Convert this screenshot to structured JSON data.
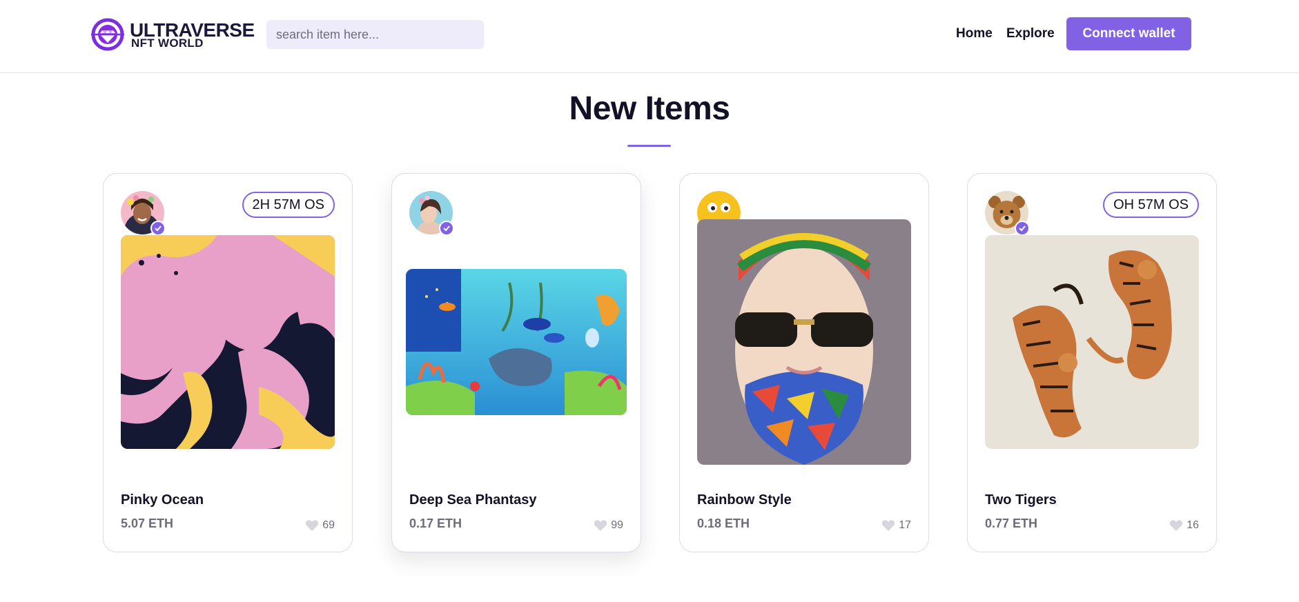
{
  "header": {
    "logo_line1": "ULTRAVERSE",
    "logo_line2": "NFT WORLD",
    "search_placeholder": "search item here...",
    "nav": {
      "home": "Home",
      "explore": "Explore"
    },
    "connect_label": "Connect wallet"
  },
  "section": {
    "title": "New Items"
  },
  "colors": {
    "accent": "#8162e4",
    "text_dark": "#131126",
    "search_bg": "#eeecfa"
  },
  "items": [
    {
      "name": "Pinky Ocean",
      "price": "5.07 ETH",
      "likes": "69",
      "countdown": "2H 57M OS"
    },
    {
      "name": "Deep Sea Phantasy",
      "price": "0.17 ETH",
      "likes": "99",
      "countdown": ""
    },
    {
      "name": "Rainbow Style",
      "price": "0.18 ETH",
      "likes": "17",
      "countdown": ""
    },
    {
      "name": "Two Tigers",
      "price": "0.77 ETH",
      "likes": "16",
      "countdown": "OH 57M OS"
    }
  ]
}
